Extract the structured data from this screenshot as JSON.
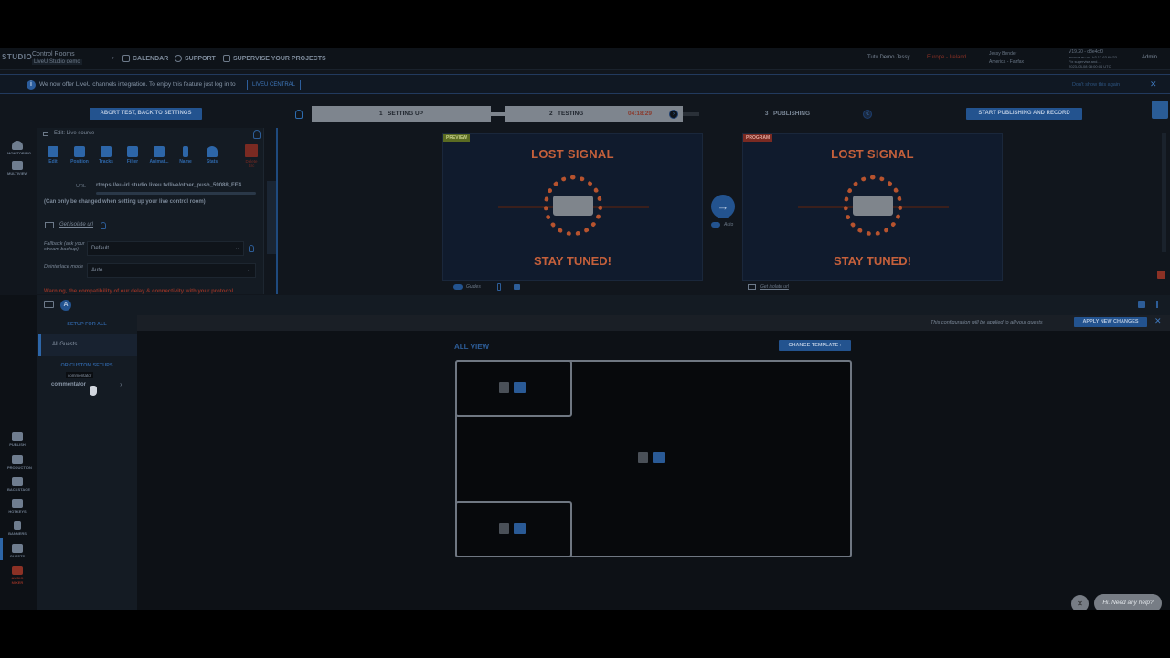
{
  "header": {
    "logo": "STUDIO",
    "room_title": "Control Rooms",
    "room_name": "LiveU Studio demo",
    "nav": [
      "CALENDAR",
      "SUPPORT",
      "SUPERVISE YOUR PROJECTS"
    ],
    "org": "Tutu Demo Jessy",
    "region": "Europe - Ireland",
    "user_name": "Jessy Bender",
    "user_tz": "America - Fairfax",
    "version": "V19.20 - d8e4cf0",
    "version_detail1": "enocus.eu-w1-b3.12.63.68/33",
    "version_detail2": "Fix supervise and...",
    "version_date": "2023-08-08 08:00:04 UTC",
    "admin": "Admin"
  },
  "banner": {
    "text": "We now offer LiveU channels integration. To enjoy this feature just log in to",
    "button": "LIVEU CENTRAL",
    "dismiss": "Don't show this again",
    "close": "✕"
  },
  "workflow": {
    "abort": "ABORT TEST, BACK TO SETTINGS",
    "steps": [
      {
        "num": "1",
        "label": "SETTING UP"
      },
      {
        "num": "2",
        "label": "TESTING"
      },
      {
        "num": "3",
        "label": "PUBLISHING"
      }
    ],
    "timer": "04:18:29",
    "start_publishing": "START PUBLISHING AND RECORD"
  },
  "left_nav_top": [
    "MONITORING",
    "MULTIVIEW"
  ],
  "left_nav_bottom": [
    "PUBLISH",
    "PRODUCTION",
    "BACKSTAGE",
    "HOTKEYS",
    "BANNERS",
    "GUESTS",
    "AUDIO MIXER"
  ],
  "source_panel": {
    "title": "Edit: Live source",
    "tools": [
      "Edit",
      "Position",
      "Tracks",
      "Filter",
      "Animat...",
      "Name",
      "Stats"
    ],
    "delete_label": "Delete",
    "delete_label2": "Src",
    "url_key": "URL",
    "url": "rtmps://eu-irl.studio.liveu.tv/live/other_push_59088_FE4",
    "note": "(Can only be changed when setting up your live control room)",
    "isolate": "Get isolate url",
    "fallback_label": "Fallback (ask your stream backup)",
    "fallback_value": "Default",
    "deinterlace_label": "Deinterlace mode",
    "deinterlace_value": "Auto",
    "warning": "Warning, the compatibility of our delay & connectivity with your protocol"
  },
  "preview": {
    "tag": "PREVIEW",
    "lost": "LOST SIGNAL",
    "stay": "STAY TUNED!",
    "guides": "Guides"
  },
  "program": {
    "tag": "PROGRAM",
    "lost": "LOST SIGNAL",
    "stay": "STAY TUNED!",
    "isolate": "Get isolate url"
  },
  "transition": {
    "arrow": "→",
    "auto": "Auto"
  },
  "guests": {
    "letter": "A",
    "setup_all": "SETUP FOR ALL",
    "all_guests": "All Guests",
    "or_custom": "OR CUSTOM SETUPS",
    "tooltip": "commentator",
    "commentator": "commentator",
    "chevron": "›",
    "config_note": "This configuration will be applied to all your guests",
    "apply": "APPLY NEW CHANGES",
    "close": "✕",
    "all_view": "ALL VIEW",
    "change_template": "CHANGE TEMPLATE ›"
  },
  "help": {
    "need_help": "Hi. Need any help?",
    "close": "✕"
  }
}
